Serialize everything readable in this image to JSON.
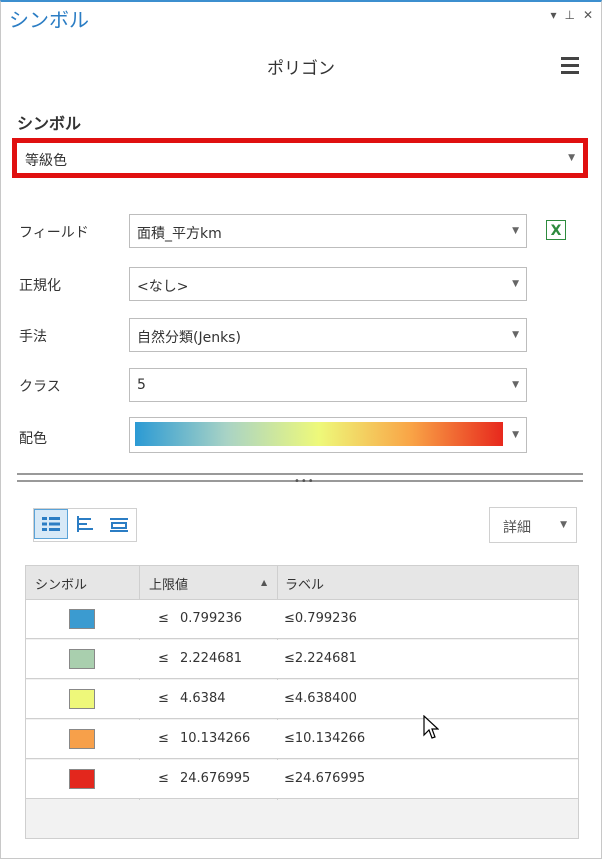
{
  "pane": {
    "title": "シンボル",
    "buttons": [
      "▾",
      "⊥",
      "✕"
    ]
  },
  "header": {
    "title": "ポリゴン"
  },
  "symbology": {
    "section_label": "シンボル",
    "type_value": "等級色"
  },
  "fields": {
    "field_label": "フィールド",
    "field_value": "面積_平方km",
    "normalization_label": "正規化",
    "normalization_value": "<なし>",
    "method_label": "手法",
    "method_value": "自然分類(Jenks)",
    "classes_label": "クラス",
    "classes_value": "5",
    "color_scheme_label": "配色",
    "color_scheme_colors": [
      "#2b9ad4",
      "#a9d3c5",
      "#eef97a",
      "#f9a446",
      "#e7281d"
    ]
  },
  "toolbar": {
    "more_label": "詳細"
  },
  "table": {
    "headers": {
      "symbol": "シンボル",
      "upper": "上限値",
      "label": "ラベル"
    },
    "rows": [
      {
        "color": "#3b9bd0",
        "le": "≤",
        "upper": "0.799236",
        "label": "≤0.799236"
      },
      {
        "color": "#a9cfae",
        "le": "≤",
        "upper": "2.224681",
        "label": "≤2.224681"
      },
      {
        "color": "#eef87a",
        "le": "≤",
        "upper": "4.6384",
        "label": "≤4.638400"
      },
      {
        "color": "#f7a04a",
        "le": "≤",
        "upper": "10.134266",
        "label": "≤10.134266"
      },
      {
        "color": "#e3271d",
        "le": "≤",
        "upper": "24.676995",
        "label": "≤24.676995"
      }
    ]
  }
}
